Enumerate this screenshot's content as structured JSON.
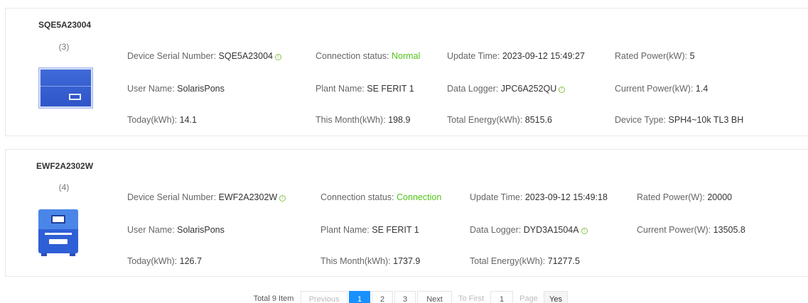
{
  "devices": [
    {
      "serial": "SQE5A23004",
      "count": "(3)",
      "fields": {
        "serial_label": "Device Serial Number:",
        "serial_value": "SQE5A23004",
        "conn_label": "Connection status:",
        "conn_value": "Normal",
        "update_label": "Update Time:",
        "update_value": "2023-09-12 15:49:27",
        "rated_label": "Rated Power(kW):",
        "rated_value": "5",
        "user_label": "User Name:",
        "user_value": "SolarisPons",
        "plant_label": "Plant Name:",
        "plant_value": "SE FERIT 1",
        "logger_label": "Data Logger:",
        "logger_value": "JPC6A252QU",
        "current_label": "Current Power(kW):",
        "current_value": "1.4",
        "today_label": "Today(kWh):",
        "today_value": "14.1",
        "month_label": "This Month(kWh):",
        "month_value": "198.9",
        "total_label": "Total Energy(kWh):",
        "total_value": "8515.6",
        "type_label": "Device Type:",
        "type_value": "SPH4~10k TL3 BH"
      }
    },
    {
      "serial": "EWF2A2302W",
      "count": "(4)",
      "fields": {
        "serial_label": "Device Serial Number:",
        "serial_value": "EWF2A2302W",
        "conn_label": "Connection status:",
        "conn_value": "Connection",
        "update_label": "Update Time:",
        "update_value": "2023-09-12 15:49:18",
        "rated_label": "Rated Power(W):",
        "rated_value": "20000",
        "user_label": "User Name:",
        "user_value": "SolarisPons",
        "plant_label": "Plant Name:",
        "plant_value": "SE FERIT 1",
        "logger_label": "Data Logger:",
        "logger_value": "DYD3A1504A",
        "current_label": "Current Power(W):",
        "current_value": "13505.8",
        "today_label": "Today(kWh):",
        "today_value": "126.7",
        "month_label": "This Month(kWh):",
        "month_value": "1737.9",
        "total_label": "Total Energy(kWh):",
        "total_value": "71277.5"
      }
    }
  ],
  "pagination": {
    "total": "Total 9 Item",
    "previous": "Previous",
    "pages": [
      "1",
      "2",
      "3"
    ],
    "next": "Next",
    "to_first": "To First",
    "page_input": "1",
    "page_label": "Page",
    "go": "Yes"
  },
  "colors": {
    "status_ok": "#52c41a",
    "accent": "#1890ff",
    "device_blue": "#2f55c9"
  },
  "icons": [
    "inverter-icon",
    "info-icon"
  ]
}
